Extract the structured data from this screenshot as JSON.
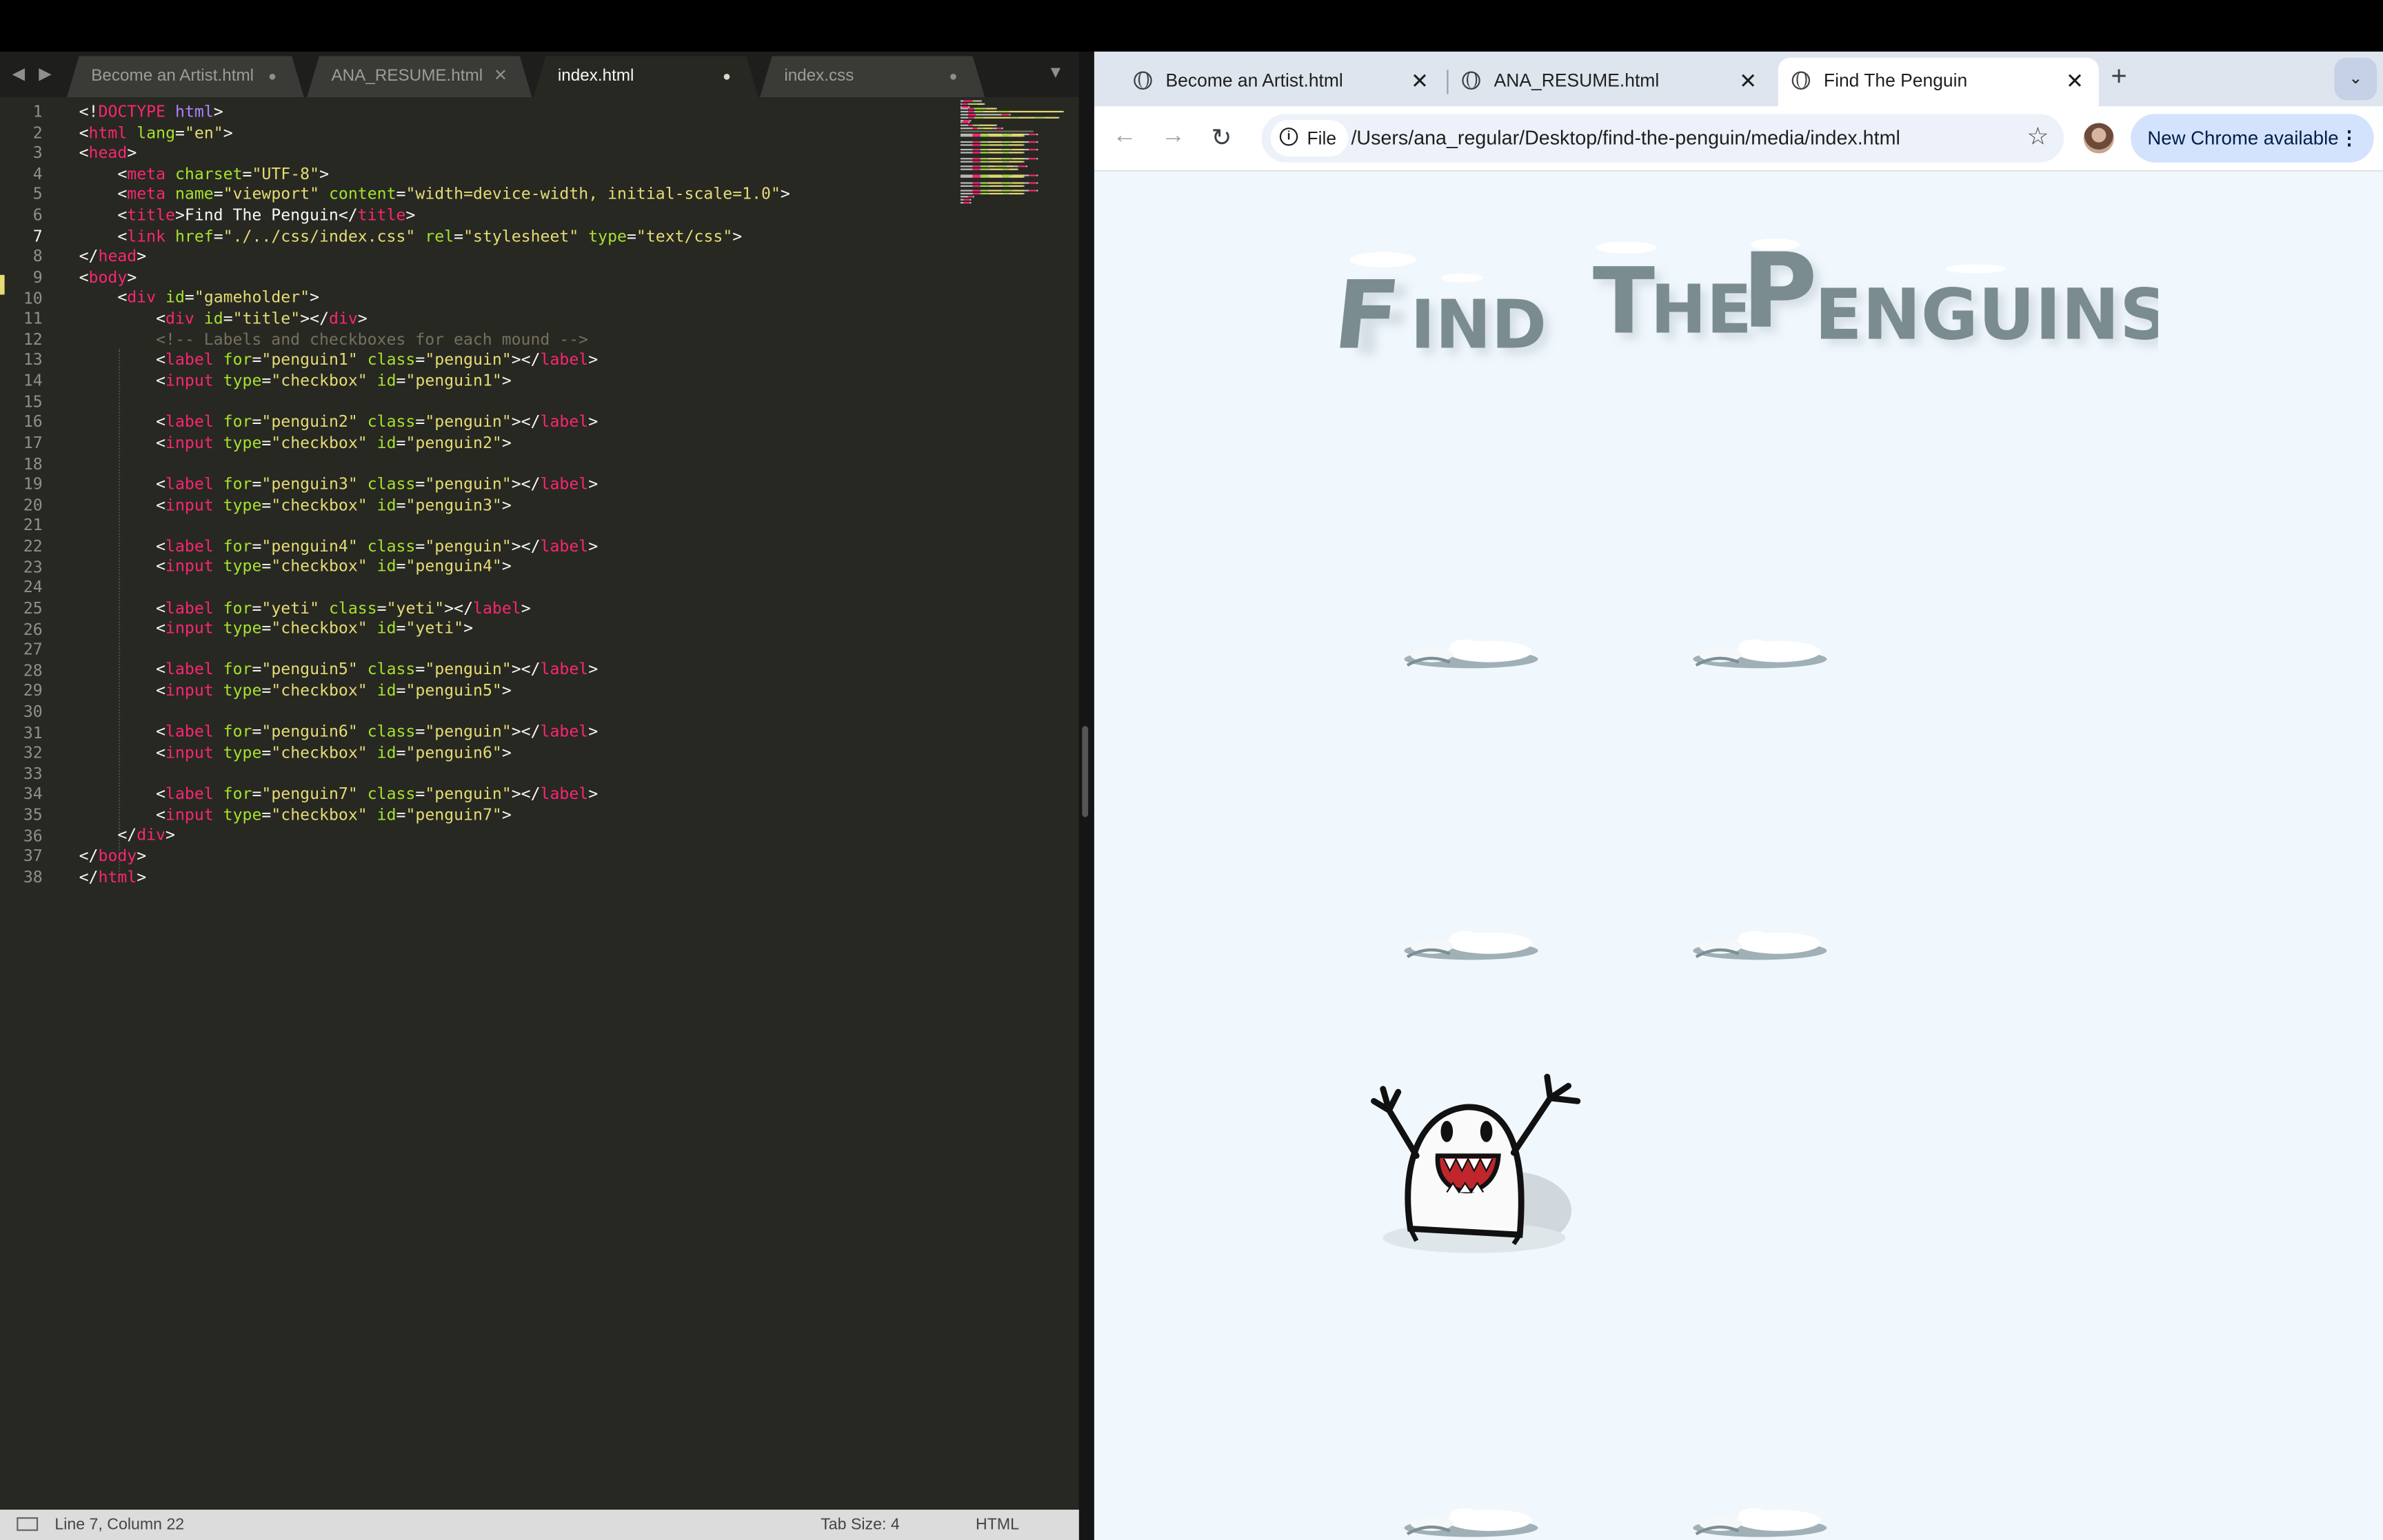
{
  "editor": {
    "nav_arrows": "◀ ▶",
    "tabs": [
      {
        "label": "Become an Artist.html",
        "state": "dot"
      },
      {
        "label": "ANA_RESUME.html",
        "state": "close"
      },
      {
        "label": "index.html",
        "state": "dot",
        "active": true
      },
      {
        "label": "index.css",
        "state": "dot"
      }
    ],
    "tab_menu_icon": "▼",
    "code_lines": [
      [
        {
          "c": "p",
          "t": "<!"
        },
        {
          "c": "t",
          "t": "DOCTYPE"
        },
        {
          "c": "p",
          "t": " "
        },
        {
          "c": "k",
          "t": "html"
        },
        {
          "c": "p",
          "t": ">"
        }
      ],
      [
        {
          "c": "p",
          "t": "<"
        },
        {
          "c": "t",
          "t": "html"
        },
        {
          "c": "p",
          "t": " "
        },
        {
          "c": "a",
          "t": "lang"
        },
        {
          "c": "p",
          "t": "="
        },
        {
          "c": "s",
          "t": "\"en\""
        },
        {
          "c": "p",
          "t": ">"
        }
      ],
      [
        {
          "c": "p",
          "t": "<"
        },
        {
          "c": "t",
          "t": "head"
        },
        {
          "c": "p",
          "t": ">"
        }
      ],
      [
        {
          "c": "p",
          "t": "    <"
        },
        {
          "c": "t",
          "t": "meta"
        },
        {
          "c": "p",
          "t": " "
        },
        {
          "c": "a",
          "t": "charset"
        },
        {
          "c": "p",
          "t": "="
        },
        {
          "c": "s",
          "t": "\"UTF-8\""
        },
        {
          "c": "p",
          "t": ">"
        }
      ],
      [
        {
          "c": "p",
          "t": "    <"
        },
        {
          "c": "t",
          "t": "meta"
        },
        {
          "c": "p",
          "t": " "
        },
        {
          "c": "a",
          "t": "name"
        },
        {
          "c": "p",
          "t": "="
        },
        {
          "c": "s",
          "t": "\"viewport\""
        },
        {
          "c": "p",
          "t": " "
        },
        {
          "c": "a",
          "t": "content"
        },
        {
          "c": "p",
          "t": "="
        },
        {
          "c": "s",
          "t": "\"width=device-width, initial-scale=1.0\""
        },
        {
          "c": "p",
          "t": ">"
        }
      ],
      [
        {
          "c": "p",
          "t": "    <"
        },
        {
          "c": "t",
          "t": "title"
        },
        {
          "c": "p",
          "t": ">Find The Penguin</"
        },
        {
          "c": "t",
          "t": "title"
        },
        {
          "c": "p",
          "t": ">"
        }
      ],
      [
        {
          "c": "p",
          "t": "    <"
        },
        {
          "c": "t",
          "t": "link"
        },
        {
          "c": "p",
          "t": " "
        },
        {
          "c": "a",
          "t": "href"
        },
        {
          "c": "p",
          "t": "="
        },
        {
          "c": "s",
          "t": "\"./../css/index.css\""
        },
        {
          "c": "p",
          "t": " "
        },
        {
          "c": "a",
          "t": "rel"
        },
        {
          "c": "p",
          "t": "="
        },
        {
          "c": "s",
          "t": "\"stylesheet\""
        },
        {
          "c": "p",
          "t": " "
        },
        {
          "c": "a",
          "t": "type"
        },
        {
          "c": "p",
          "t": "="
        },
        {
          "c": "s",
          "t": "\"text/css\""
        },
        {
          "c": "p",
          "t": ">"
        }
      ],
      [
        {
          "c": "p",
          "t": "</"
        },
        {
          "c": "t",
          "t": "head"
        },
        {
          "c": "p",
          "t": ">"
        }
      ],
      [
        {
          "c": "p",
          "t": "<"
        },
        {
          "c": "t",
          "t": "body"
        },
        {
          "c": "p",
          "t": ">"
        }
      ],
      [
        {
          "c": "p",
          "t": "    <"
        },
        {
          "c": "t",
          "t": "div"
        },
        {
          "c": "p",
          "t": " "
        },
        {
          "c": "a",
          "t": "id"
        },
        {
          "c": "p",
          "t": "="
        },
        {
          "c": "s",
          "t": "\"gameholder\""
        },
        {
          "c": "p",
          "t": ">"
        }
      ],
      [
        {
          "c": "p",
          "t": "        <"
        },
        {
          "c": "t",
          "t": "div"
        },
        {
          "c": "p",
          "t": " "
        },
        {
          "c": "a",
          "t": "id"
        },
        {
          "c": "p",
          "t": "="
        },
        {
          "c": "s",
          "t": "\"title\""
        },
        {
          "c": "p",
          "t": "></"
        },
        {
          "c": "t",
          "t": "div"
        },
        {
          "c": "p",
          "t": ">"
        }
      ],
      [
        {
          "c": "c",
          "t": "        <!-- Labels and checkboxes for each mound -->"
        }
      ],
      [
        {
          "c": "p",
          "t": "        <"
        },
        {
          "c": "t",
          "t": "label"
        },
        {
          "c": "p",
          "t": " "
        },
        {
          "c": "a",
          "t": "for"
        },
        {
          "c": "p",
          "t": "="
        },
        {
          "c": "s",
          "t": "\"penguin1\""
        },
        {
          "c": "p",
          "t": " "
        },
        {
          "c": "a",
          "t": "class"
        },
        {
          "c": "p",
          "t": "="
        },
        {
          "c": "s",
          "t": "\"penguin\""
        },
        {
          "c": "p",
          "t": "></"
        },
        {
          "c": "t",
          "t": "label"
        },
        {
          "c": "p",
          "t": ">"
        }
      ],
      [
        {
          "c": "p",
          "t": "        <"
        },
        {
          "c": "t",
          "t": "input"
        },
        {
          "c": "p",
          "t": " "
        },
        {
          "c": "a",
          "t": "type"
        },
        {
          "c": "p",
          "t": "="
        },
        {
          "c": "s",
          "t": "\"checkbox\""
        },
        {
          "c": "p",
          "t": " "
        },
        {
          "c": "a",
          "t": "id"
        },
        {
          "c": "p",
          "t": "="
        },
        {
          "c": "s",
          "t": "\"penguin1\""
        },
        {
          "c": "p",
          "t": ">"
        }
      ],
      [],
      [
        {
          "c": "p",
          "t": "        <"
        },
        {
          "c": "t",
          "t": "label"
        },
        {
          "c": "p",
          "t": " "
        },
        {
          "c": "a",
          "t": "for"
        },
        {
          "c": "p",
          "t": "="
        },
        {
          "c": "s",
          "t": "\"penguin2\""
        },
        {
          "c": "p",
          "t": " "
        },
        {
          "c": "a",
          "t": "class"
        },
        {
          "c": "p",
          "t": "="
        },
        {
          "c": "s",
          "t": "\"penguin\""
        },
        {
          "c": "p",
          "t": "></"
        },
        {
          "c": "t",
          "t": "label"
        },
        {
          "c": "p",
          "t": ">"
        }
      ],
      [
        {
          "c": "p",
          "t": "        <"
        },
        {
          "c": "t",
          "t": "input"
        },
        {
          "c": "p",
          "t": " "
        },
        {
          "c": "a",
          "t": "type"
        },
        {
          "c": "p",
          "t": "="
        },
        {
          "c": "s",
          "t": "\"checkbox\""
        },
        {
          "c": "p",
          "t": " "
        },
        {
          "c": "a",
          "t": "id"
        },
        {
          "c": "p",
          "t": "="
        },
        {
          "c": "s",
          "t": "\"penguin2\""
        },
        {
          "c": "p",
          "t": ">"
        }
      ],
      [],
      [
        {
          "c": "p",
          "t": "        <"
        },
        {
          "c": "t",
          "t": "label"
        },
        {
          "c": "p",
          "t": " "
        },
        {
          "c": "a",
          "t": "for"
        },
        {
          "c": "p",
          "t": "="
        },
        {
          "c": "s",
          "t": "\"penguin3\""
        },
        {
          "c": "p",
          "t": " "
        },
        {
          "c": "a",
          "t": "class"
        },
        {
          "c": "p",
          "t": "="
        },
        {
          "c": "s",
          "t": "\"penguin\""
        },
        {
          "c": "p",
          "t": "></"
        },
        {
          "c": "t",
          "t": "label"
        },
        {
          "c": "p",
          "t": ">"
        }
      ],
      [
        {
          "c": "p",
          "t": "        <"
        },
        {
          "c": "t",
          "t": "input"
        },
        {
          "c": "p",
          "t": " "
        },
        {
          "c": "a",
          "t": "type"
        },
        {
          "c": "p",
          "t": "="
        },
        {
          "c": "s",
          "t": "\"checkbox\""
        },
        {
          "c": "p",
          "t": " "
        },
        {
          "c": "a",
          "t": "id"
        },
        {
          "c": "p",
          "t": "="
        },
        {
          "c": "s",
          "t": "\"penguin3\""
        },
        {
          "c": "p",
          "t": ">"
        }
      ],
      [],
      [
        {
          "c": "p",
          "t": "        <"
        },
        {
          "c": "t",
          "t": "label"
        },
        {
          "c": "p",
          "t": " "
        },
        {
          "c": "a",
          "t": "for"
        },
        {
          "c": "p",
          "t": "="
        },
        {
          "c": "s",
          "t": "\"penguin4\""
        },
        {
          "c": "p",
          "t": " "
        },
        {
          "c": "a",
          "t": "class"
        },
        {
          "c": "p",
          "t": "="
        },
        {
          "c": "s",
          "t": "\"penguin\""
        },
        {
          "c": "p",
          "t": "></"
        },
        {
          "c": "t",
          "t": "label"
        },
        {
          "c": "p",
          "t": ">"
        }
      ],
      [
        {
          "c": "p",
          "t": "        <"
        },
        {
          "c": "t",
          "t": "input"
        },
        {
          "c": "p",
          "t": " "
        },
        {
          "c": "a",
          "t": "type"
        },
        {
          "c": "p",
          "t": "="
        },
        {
          "c": "s",
          "t": "\"checkbox\""
        },
        {
          "c": "p",
          "t": " "
        },
        {
          "c": "a",
          "t": "id"
        },
        {
          "c": "p",
          "t": "="
        },
        {
          "c": "s",
          "t": "\"penguin4\""
        },
        {
          "c": "p",
          "t": ">"
        }
      ],
      [],
      [
        {
          "c": "p",
          "t": "        <"
        },
        {
          "c": "t",
          "t": "label"
        },
        {
          "c": "p",
          "t": " "
        },
        {
          "c": "a",
          "t": "for"
        },
        {
          "c": "p",
          "t": "="
        },
        {
          "c": "s",
          "t": "\"yeti\""
        },
        {
          "c": "p",
          "t": " "
        },
        {
          "c": "a",
          "t": "class"
        },
        {
          "c": "p",
          "t": "="
        },
        {
          "c": "s",
          "t": "\"yeti\""
        },
        {
          "c": "p",
          "t": "></"
        },
        {
          "c": "t",
          "t": "label"
        },
        {
          "c": "p",
          "t": ">"
        }
      ],
      [
        {
          "c": "p",
          "t": "        <"
        },
        {
          "c": "t",
          "t": "input"
        },
        {
          "c": "p",
          "t": " "
        },
        {
          "c": "a",
          "t": "type"
        },
        {
          "c": "p",
          "t": "="
        },
        {
          "c": "s",
          "t": "\"checkbox\""
        },
        {
          "c": "p",
          "t": " "
        },
        {
          "c": "a",
          "t": "id"
        },
        {
          "c": "p",
          "t": "="
        },
        {
          "c": "s",
          "t": "\"yeti\""
        },
        {
          "c": "p",
          "t": ">"
        }
      ],
      [],
      [
        {
          "c": "p",
          "t": "        <"
        },
        {
          "c": "t",
          "t": "label"
        },
        {
          "c": "p",
          "t": " "
        },
        {
          "c": "a",
          "t": "for"
        },
        {
          "c": "p",
          "t": "="
        },
        {
          "c": "s",
          "t": "\"penguin5\""
        },
        {
          "c": "p",
          "t": " "
        },
        {
          "c": "a",
          "t": "class"
        },
        {
          "c": "p",
          "t": "="
        },
        {
          "c": "s",
          "t": "\"penguin\""
        },
        {
          "c": "p",
          "t": "></"
        },
        {
          "c": "t",
          "t": "label"
        },
        {
          "c": "p",
          "t": ">"
        }
      ],
      [
        {
          "c": "p",
          "t": "        <"
        },
        {
          "c": "t",
          "t": "input"
        },
        {
          "c": "p",
          "t": " "
        },
        {
          "c": "a",
          "t": "type"
        },
        {
          "c": "p",
          "t": "="
        },
        {
          "c": "s",
          "t": "\"checkbox\""
        },
        {
          "c": "p",
          "t": " "
        },
        {
          "c": "a",
          "t": "id"
        },
        {
          "c": "p",
          "t": "="
        },
        {
          "c": "s",
          "t": "\"penguin5\""
        },
        {
          "c": "p",
          "t": ">"
        }
      ],
      [],
      [
        {
          "c": "p",
          "t": "        <"
        },
        {
          "c": "t",
          "t": "label"
        },
        {
          "c": "p",
          "t": " "
        },
        {
          "c": "a",
          "t": "for"
        },
        {
          "c": "p",
          "t": "="
        },
        {
          "c": "s",
          "t": "\"penguin6\""
        },
        {
          "c": "p",
          "t": " "
        },
        {
          "c": "a",
          "t": "class"
        },
        {
          "c": "p",
          "t": "="
        },
        {
          "c": "s",
          "t": "\"penguin\""
        },
        {
          "c": "p",
          "t": "></"
        },
        {
          "c": "t",
          "t": "label"
        },
        {
          "c": "p",
          "t": ">"
        }
      ],
      [
        {
          "c": "p",
          "t": "        <"
        },
        {
          "c": "t",
          "t": "input"
        },
        {
          "c": "p",
          "t": " "
        },
        {
          "c": "a",
          "t": "type"
        },
        {
          "c": "p",
          "t": "="
        },
        {
          "c": "s",
          "t": "\"checkbox\""
        },
        {
          "c": "p",
          "t": " "
        },
        {
          "c": "a",
          "t": "id"
        },
        {
          "c": "p",
          "t": "="
        },
        {
          "c": "s",
          "t": "\"penguin6\""
        },
        {
          "c": "p",
          "t": ">"
        }
      ],
      [],
      [
        {
          "c": "p",
          "t": "        <"
        },
        {
          "c": "t",
          "t": "label"
        },
        {
          "c": "p",
          "t": " "
        },
        {
          "c": "a",
          "t": "for"
        },
        {
          "c": "p",
          "t": "="
        },
        {
          "c": "s",
          "t": "\"penguin7\""
        },
        {
          "c": "p",
          "t": " "
        },
        {
          "c": "a",
          "t": "class"
        },
        {
          "c": "p",
          "t": "="
        },
        {
          "c": "s",
          "t": "\"penguin\""
        },
        {
          "c": "p",
          "t": "></"
        },
        {
          "c": "t",
          "t": "label"
        },
        {
          "c": "p",
          "t": ">"
        }
      ],
      [
        {
          "c": "p",
          "t": "        <"
        },
        {
          "c": "t",
          "t": "input"
        },
        {
          "c": "p",
          "t": " "
        },
        {
          "c": "a",
          "t": "type"
        },
        {
          "c": "p",
          "t": "="
        },
        {
          "c": "s",
          "t": "\"checkbox\""
        },
        {
          "c": "p",
          "t": " "
        },
        {
          "c": "a",
          "t": "id"
        },
        {
          "c": "p",
          "t": "="
        },
        {
          "c": "s",
          "t": "\"penguin7\""
        },
        {
          "c": "p",
          "t": ">"
        }
      ],
      [
        {
          "c": "p",
          "t": "    </"
        },
        {
          "c": "t",
          "t": "div"
        },
        {
          "c": "p",
          "t": ">"
        }
      ],
      [
        {
          "c": "p",
          "t": "</"
        },
        {
          "c": "t",
          "t": "body"
        },
        {
          "c": "p",
          "t": ">"
        }
      ],
      [
        {
          "c": "p",
          "t": "</"
        },
        {
          "c": "t",
          "t": "html"
        },
        {
          "c": "p",
          "t": ">"
        }
      ]
    ],
    "current_line": 7,
    "status": {
      "position": "Line 7, Column 22",
      "tab_size": "Tab Size: 4",
      "syntax": "HTML"
    }
  },
  "browser": {
    "tabs": [
      {
        "label": "Become an Artist.html",
        "close": "✕"
      },
      {
        "label": "ANA_RESUME.html",
        "close": "✕"
      },
      {
        "label": "Find The Penguin",
        "close": "✕",
        "active": true
      }
    ],
    "new_tab": "+",
    "tab_menu": "⌄",
    "back_icon": "←",
    "forward_icon": "→",
    "reload_icon": "↻",
    "file_chip": "File",
    "url": "/Users/ana_regular/Desktop/find-the-penguin/media/index.html",
    "bookmark_icon": "☆",
    "update_button": "New Chrome available",
    "update_menu": "⋮"
  },
  "page": {
    "title_art": "Find The Penguins",
    "mounds": [
      "penguin1",
      "penguin2",
      "penguin3",
      "penguin4",
      "penguin5",
      "penguin6"
    ],
    "revealed": "yeti"
  },
  "colors": {
    "editor_bg": "#272822",
    "page_bg": "#f0f7fd",
    "keyword": "#f92672",
    "attr": "#a6e22e",
    "string": "#e6db74"
  }
}
